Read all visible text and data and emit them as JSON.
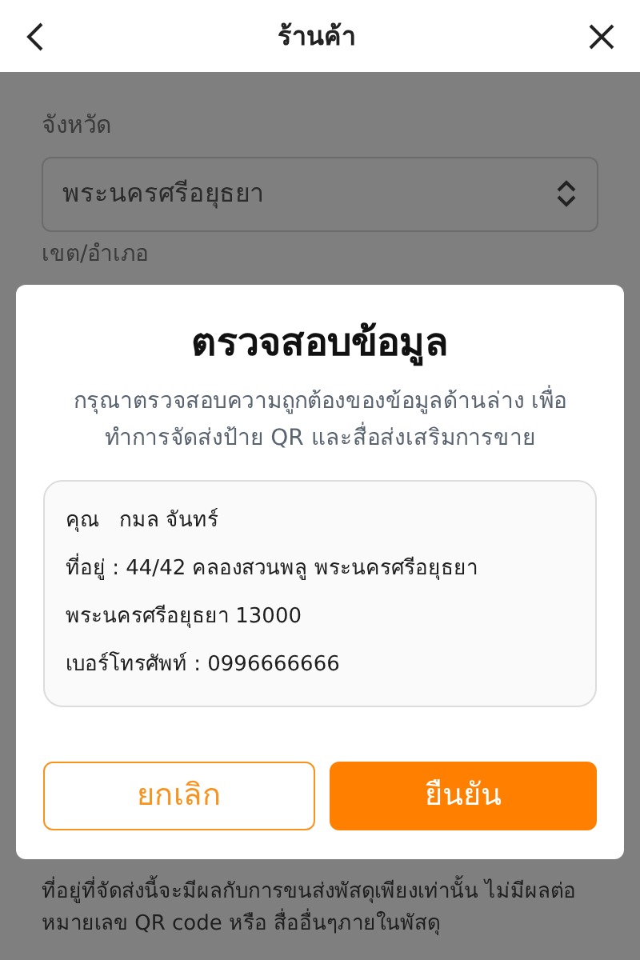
{
  "header": {
    "title": "ร้านค้า"
  },
  "form": {
    "province_label": "จังหวัด",
    "province_value": "พระนครศรีอยุธยา",
    "district_label": "เขต/อำเภอ",
    "note": "ที่อยู่ที่จัดส่งนี้จะมีผลกับการขนส่งพัสดุเพียงเท่านั้น ไม่มีผลต่อหมายเลข QR code หรือ สื่ออื่นๆภายในพัสดุ"
  },
  "dialog": {
    "title": "ตรวจสอบข้อมูล",
    "message": "กรุณาตรวจสอบความถูกต้องของข้อมูลด้านล่าง เพื่อทำการจัดส่งป้าย QR และสื่อส่งเสริมการขาย",
    "lines": [
      "คุณ   กมล จันทร์",
      "ที่อยู่ : 44/42 คลองสวนพลู พระนครศรีอยุธยา",
      "พระนครศรีอยุธยา 13000",
      "เบอร์โทรศัพท์ : 0996666666"
    ],
    "buttons": [
      {
        "label": "ยกเลิก",
        "kind": "secondary"
      },
      {
        "label": "ยืนยัน",
        "kind": "primary"
      }
    ]
  }
}
